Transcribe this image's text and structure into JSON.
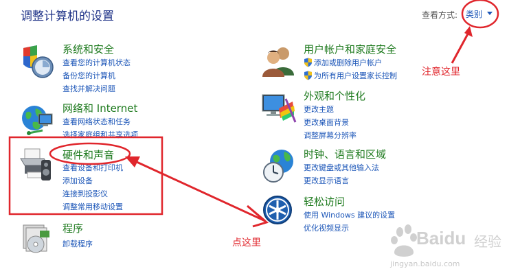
{
  "header": {
    "title": "调整计算机的设置",
    "view_label": "查看方式:",
    "view_value": "类别"
  },
  "left_categories": [
    {
      "title": "系统和安全",
      "links": [
        "查看您的计算机状态",
        "备份您的计算机",
        "查找并解决问题"
      ]
    },
    {
      "title": "网络和 Internet",
      "links": [
        "查看网络状态和任务",
        "选择家庭组和共享选项"
      ]
    },
    {
      "title": "硬件和声音",
      "links": [
        "查看设备和打印机",
        "添加设备",
        "连接到投影仪",
        "调整常用移动设置"
      ]
    },
    {
      "title": "程序",
      "links": [
        "卸载程序"
      ]
    }
  ],
  "right_categories": [
    {
      "title": "用户帐户和家庭安全",
      "links": [
        "添加或删除用户帐户",
        "为所有用户设置家长控制"
      ]
    },
    {
      "title": "外观和个性化",
      "links": [
        "更改主题",
        "更改桌面背景",
        "调整屏幕分辨率"
      ]
    },
    {
      "title": "时钟、语言和区域",
      "links": [
        "更改键盘或其他输入法",
        "更改显示语言"
      ]
    },
    {
      "title": "轻松访问",
      "links": [
        "使用 Windows 建议的设置",
        "优化视频显示"
      ]
    }
  ],
  "annotations": {
    "note_here": "注意这里",
    "click_here": "点这里",
    "accent_color": "#e0262c"
  },
  "watermark": {
    "brand": "Baidu",
    "brand_cn": "经验",
    "url": "jingyan.baidu.com"
  },
  "colors": {
    "title_text": "#1e3287",
    "category_title": "#1e7a1e",
    "link": "#1c56b8"
  }
}
